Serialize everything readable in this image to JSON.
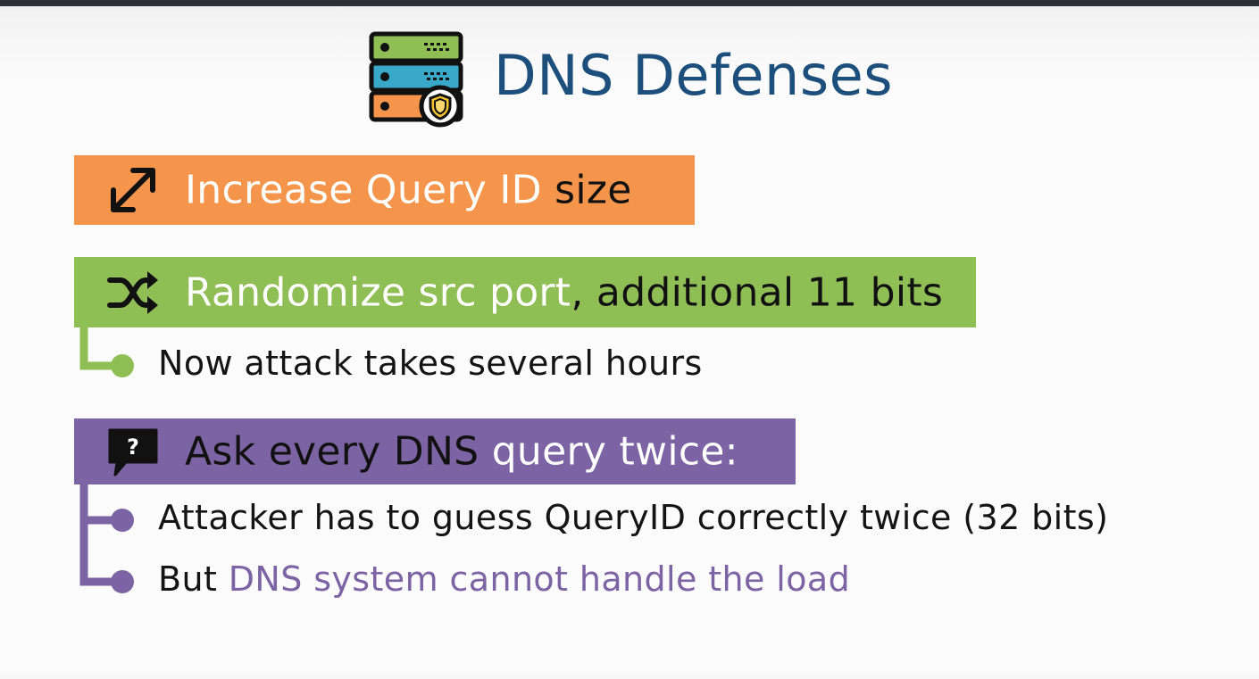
{
  "title": "DNS Defenses",
  "colors": {
    "title": "#1c4f7c",
    "orange": "#f5944b",
    "green": "#8fbe55",
    "purple": "#7c63a3"
  },
  "icons": {
    "header": "server-shield-icon",
    "item1": "resize-arrow-icon",
    "item2": "shuffle-icon",
    "item3": "question-bubble-icon"
  },
  "items": [
    {
      "text_white": "Increase Query ID ",
      "text_dark": "size"
    },
    {
      "text_white": "Randomize src port",
      "text_dark": ", additional 11 bits",
      "bullets": [
        {
          "text": "Now attack takes several hours"
        }
      ]
    },
    {
      "text_dark": "Ask every DNS ",
      "text_white": "query twice:",
      "bullets": [
        {
          "text": "Attacker has to guess QueryID correctly twice (32 bits)"
        },
        {
          "text_dark": "But ",
          "text_purple": "DNS system cannot handle the load"
        }
      ]
    }
  ]
}
